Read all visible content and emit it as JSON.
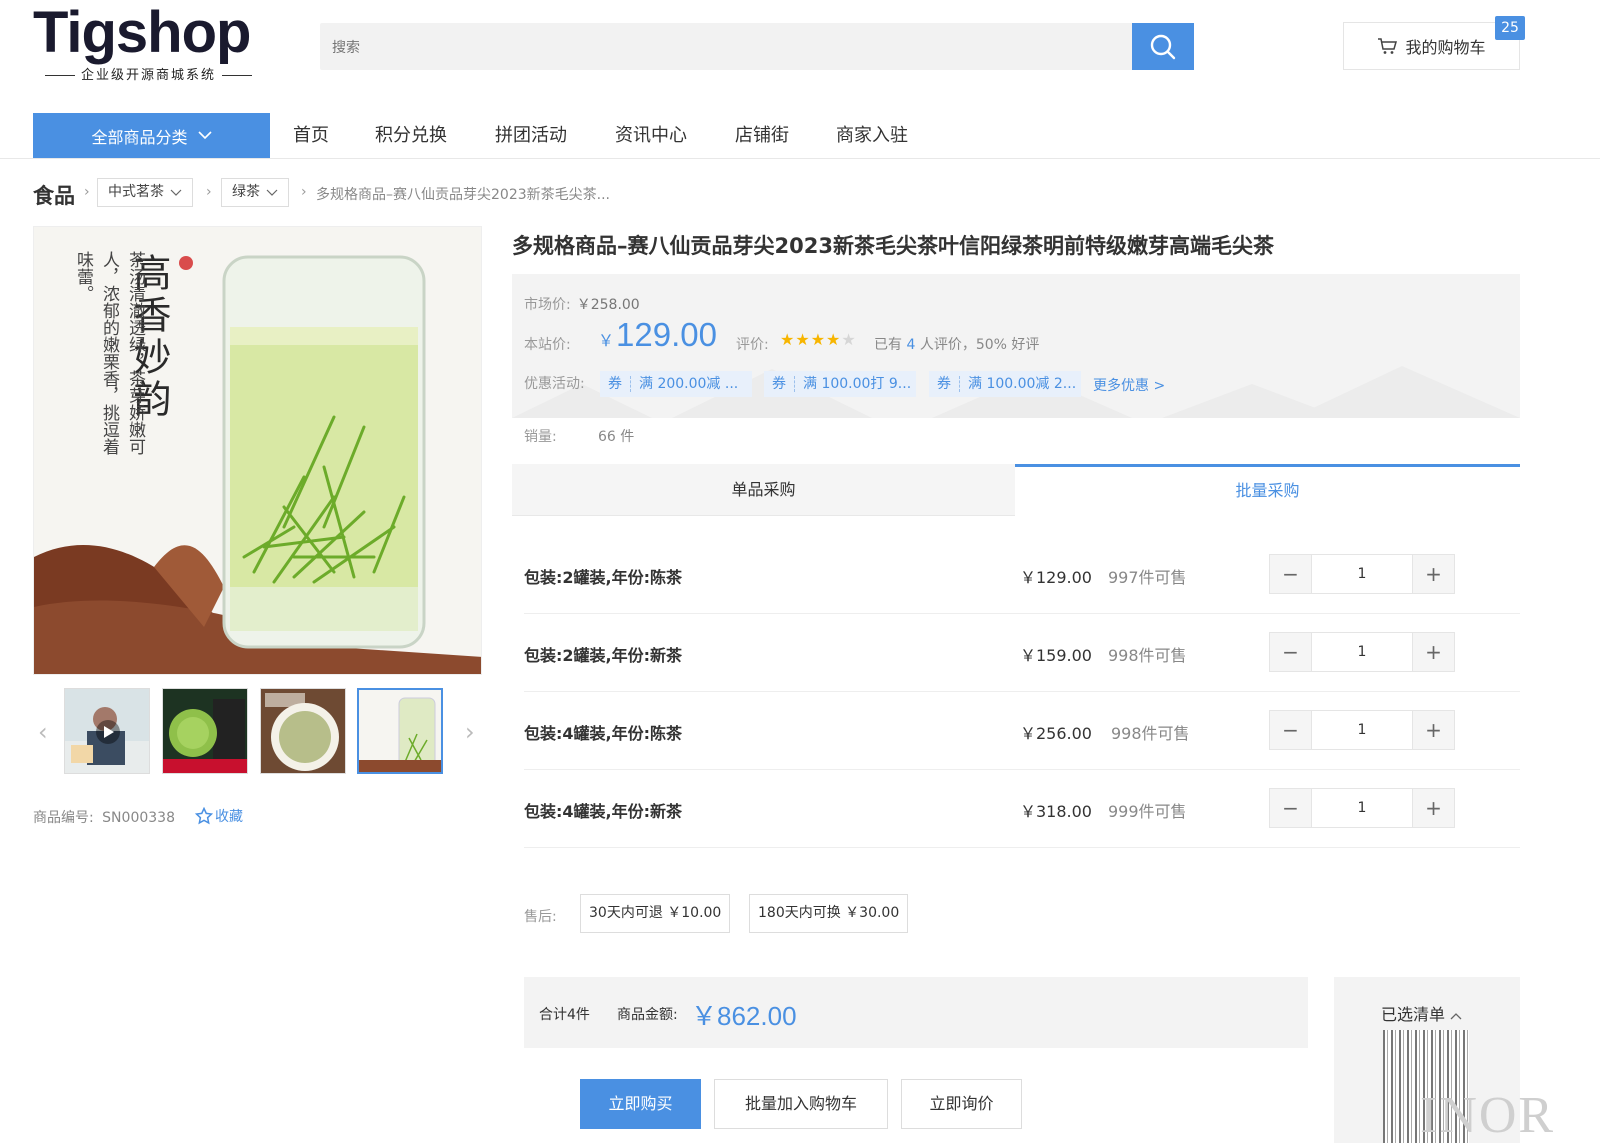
{
  "logo": {
    "brand": "Tigshop",
    "tagline": "企业级开源商城系统"
  },
  "search": {
    "placeholder": "搜索"
  },
  "cart": {
    "label": "我的购物车",
    "count": "25"
  },
  "nav": {
    "all_categories": "全部商品分类",
    "items": [
      "首页",
      "积分兑换",
      "拼团活动",
      "资讯中心",
      "店铺街",
      "商家入驻"
    ]
  },
  "breadcrumb": {
    "root": "食品",
    "level1": "中式茗茶",
    "level2": "绿茶",
    "current": "多规格商品–赛八仙贡品芽尖2023新茶毛尖茶..."
  },
  "gallery": {
    "main_text_title": "高香妙韵",
    "main_text_body": "茶汤清澈透绿，茶芽娇嫩可人，浓郁的嫩栗香，挑逗着味蕾。",
    "thumbs": [
      "video",
      "product-tins",
      "tea-bowl",
      "tea-glass"
    ],
    "selected_thumb": 3
  },
  "sku": {
    "label": "商品编号:",
    "value": "SN000338",
    "favorite": "收藏"
  },
  "product": {
    "title": "多规格商品–赛八仙贡品芽尖2023新茶毛尖茶叶信阳绿茶明前特级嫩芽高端毛尖茶",
    "market_label": "市场价:",
    "market_price": "￥258.00",
    "our_label": "本站价:",
    "currency": "￥",
    "our_price": "129.00",
    "rating_label": "评价:",
    "rating": 4,
    "rating_max": 5,
    "review_pre": "已有",
    "review_count": "4",
    "review_post": "人评价，50% 好评",
    "promo_label": "优惠活动:",
    "coupons": [
      {
        "tag": "券",
        "text": "满 200.00减 ..."
      },
      {
        "tag": "券",
        "text": "满 100.00打 9..."
      },
      {
        "tag": "券",
        "text": "满 100.00减 2..."
      }
    ],
    "more_promo": "更多优惠 >",
    "sales_label": "销量:",
    "sales": "66 件"
  },
  "tabs": {
    "single": "单品采购",
    "bulk": "批量采购",
    "active": "bulk"
  },
  "variants": [
    {
      "spec": "包装:2罐装,年份:陈茶",
      "price": "￥129.00",
      "stock": "997件可售",
      "qty": "1"
    },
    {
      "spec": "包装:2罐装,年份:新茶",
      "price": "￥159.00",
      "stock": "998件可售",
      "qty": "1"
    },
    {
      "spec": "包装:4罐装,年份:陈茶",
      "price": "￥256.00",
      "stock": "998件可售",
      "qty": "1"
    },
    {
      "spec": "包装:4罐装,年份:新茶",
      "price": "￥318.00",
      "stock": "999件可售",
      "qty": "1"
    }
  ],
  "after_sale": {
    "label": "售后:",
    "options": [
      "30天内可退  ￥10.00",
      "180天内可换  ￥30.00"
    ]
  },
  "total": {
    "count": "合计4件",
    "amount_label": "商品金额:",
    "amount": "￥862.00",
    "selected_list": "已选清单"
  },
  "actions": {
    "buy_now": "立即购买",
    "add_to_cart": "批量加入购物车",
    "inquire": "立即询价"
  },
  "watermark": "INOR",
  "colors": {
    "accent": "#4a90e2",
    "star": "#f7b500"
  }
}
